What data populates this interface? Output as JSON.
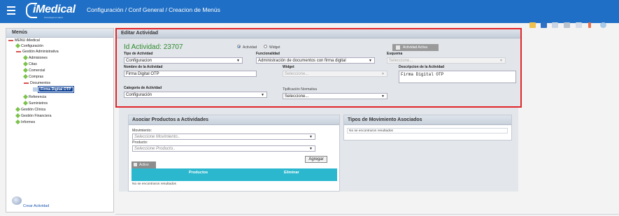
{
  "topbar": {
    "logo_text": "iMedical",
    "logo_sub": "Tecnología en salud",
    "breadcrumb": "Configuración / Conf General / Creacion de Menús",
    "bg_color": "#1f6fc6"
  },
  "menu_panel": {
    "title": "Menús",
    "tree": [
      "MENU iMedical",
      "Configuración",
      "Gestión Administrativa",
      "Admisiones",
      "Citas",
      "Comercial",
      "Compras",
      "Documentos",
      "Firma Digital OTP",
      "Referencia",
      "Suministros",
      "Gestión Clínica",
      "Gestión Financiera",
      "Informes"
    ],
    "create_label": "Crear Actividad"
  },
  "edit_panel": {
    "title": "Editar Actividad",
    "id_label": "Id Actividad: 23707",
    "radio_actividad": "Actividad",
    "radio_widget": "Widget",
    "active_button": "Actividad Activa",
    "tipo_label": "Tipo de Actividad",
    "tipo_value": "Configuracion",
    "func_label": "Funcionalidad",
    "func_value": "Administración de documentos con firma digital",
    "esquema_label": "Esquema",
    "esquema_value": "Seleccione...",
    "nombre_label": "Nombre de la Actividad",
    "nombre_value": "Firma Digital OTP",
    "widget_label": "Widget",
    "widget_value": "Seleccione...",
    "desc_label": "Descripcion de la Actividad",
    "desc_value": "Firma Digital OTP",
    "cat_label": "Categoria de Actividad",
    "cat_value": "Configuración",
    "tipif_label": "Tipificación Normativa",
    "tipif_value": "Seleccione...",
    "border_color": "#e0262b"
  },
  "asociar": {
    "title": "Asociar Productos a Actividades",
    "mov_label": "Movimiento:",
    "mov_placeholder": "Seleccione Movimiento..",
    "prod_label": "Producto:",
    "prod_placeholder": "Seleccione Producto..",
    "add_button": "Agregar",
    "activo_button": "Activo",
    "col_productos": "Productos",
    "col_eliminar": "Eliminar",
    "no_results": "No se encontraron resultados"
  },
  "tipos": {
    "title": "Tipos de Movimiento Asociados",
    "no_results": "No se encontraron resultados"
  }
}
